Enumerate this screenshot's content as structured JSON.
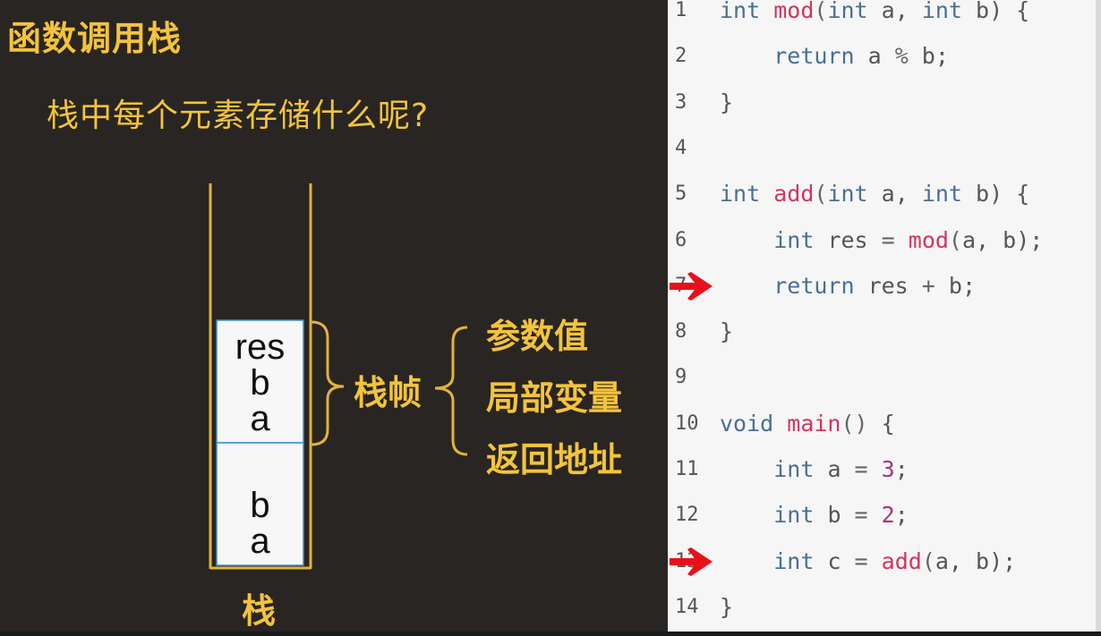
{
  "slide": {
    "title": "函数调用栈",
    "question": "栈中每个元素存储什么呢?",
    "stack_label": "栈",
    "frame_label": "栈帧",
    "frame_contents": [
      "参数值",
      "局部变量",
      "返回地址"
    ],
    "top_frame_vars": [
      "res",
      "b",
      "a"
    ],
    "bottom_frame_vars": [
      "b",
      "a"
    ]
  },
  "code": {
    "lines": [
      {
        "num": "1",
        "tokens": [
          [
            "kw",
            "int "
          ],
          [
            "fn",
            "mod"
          ],
          [
            "op",
            "("
          ],
          [
            "kw",
            "int "
          ],
          [
            "",
            "a, "
          ],
          [
            "kw",
            "int "
          ],
          [
            "",
            "b) {"
          ]
        ]
      },
      {
        "num": "2",
        "tokens": [
          [
            "",
            "    "
          ],
          [
            "kw",
            "return "
          ],
          [
            "",
            "a "
          ],
          [
            "op",
            "% "
          ],
          [
            "",
            "b;"
          ]
        ]
      },
      {
        "num": "3",
        "tokens": [
          [
            "",
            "}"
          ]
        ]
      },
      {
        "num": "4",
        "tokens": []
      },
      {
        "num": "5",
        "tokens": [
          [
            "kw",
            "int "
          ],
          [
            "fn",
            "add"
          ],
          [
            "op",
            "("
          ],
          [
            "kw",
            "int "
          ],
          [
            "",
            "a, "
          ],
          [
            "kw",
            "int "
          ],
          [
            "",
            "b) {"
          ]
        ]
      },
      {
        "num": "6",
        "tokens": [
          [
            "",
            "    "
          ],
          [
            "kw",
            "int "
          ],
          [
            "",
            "res "
          ],
          [
            "op",
            "= "
          ],
          [
            "fn",
            "mod"
          ],
          [
            "op",
            "("
          ],
          [
            "",
            "a, b);"
          ]
        ]
      },
      {
        "num": "7",
        "tokens": [
          [
            "",
            "    "
          ],
          [
            "kw",
            "return "
          ],
          [
            "",
            "res "
          ],
          [
            "op",
            "+ "
          ],
          [
            "",
            "b;"
          ]
        ]
      },
      {
        "num": "8",
        "tokens": [
          [
            "",
            "}"
          ]
        ]
      },
      {
        "num": "9",
        "tokens": []
      },
      {
        "num": "10",
        "tokens": [
          [
            "kw",
            "void "
          ],
          [
            "fn",
            "main"
          ],
          [
            "op",
            "() "
          ],
          [
            "",
            "{"
          ]
        ]
      },
      {
        "num": "11",
        "tokens": [
          [
            "",
            "    "
          ],
          [
            "kw",
            "int "
          ],
          [
            "",
            "a "
          ],
          [
            "op",
            "= "
          ],
          [
            "num",
            "3"
          ],
          [
            "",
            ";"
          ]
        ]
      },
      {
        "num": "12",
        "tokens": [
          [
            "",
            "    "
          ],
          [
            "kw",
            "int "
          ],
          [
            "",
            "b "
          ],
          [
            "op",
            "= "
          ],
          [
            "num",
            "2"
          ],
          [
            "",
            ";"
          ]
        ]
      },
      {
        "num": "13",
        "tokens": [
          [
            "",
            "    "
          ],
          [
            "kw",
            "int "
          ],
          [
            "",
            "c "
          ],
          [
            "op",
            "= "
          ],
          [
            "fn",
            "add"
          ],
          [
            "op",
            "("
          ],
          [
            "",
            "a, b);"
          ]
        ]
      },
      {
        "num": "14",
        "tokens": [
          [
            "",
            "}"
          ]
        ]
      }
    ],
    "arrow_lines": [
      "7",
      "13"
    ]
  },
  "colors": {
    "background": "#292522",
    "accent_yellow": "#f3c33c",
    "arrow_red": "#e8101a",
    "code_bg": "#f6f6f6"
  }
}
